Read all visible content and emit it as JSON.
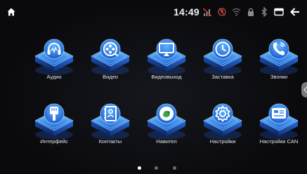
{
  "status_bar": {
    "time": "14:49",
    "icons": [
      "home-icon",
      "signal-off-icon",
      "mic-off-icon",
      "wifi-icon",
      "lock-icon",
      "bluetooth-icon",
      "window-icon",
      "back-arrow-icon"
    ],
    "muted_color": "#8a8a90",
    "alert_color": "#c0392b"
  },
  "apps": [
    {
      "label": "Аудио",
      "icon": "headphones-icon"
    },
    {
      "label": "Видео",
      "icon": "film-reel-icon"
    },
    {
      "label": "Видеовыход",
      "icon": "screen-cast-icon"
    },
    {
      "label": "Заставка",
      "icon": "clock-icon"
    },
    {
      "label": "Звонки",
      "icon": "phone-call-icon"
    },
    {
      "label": "Интерфейс",
      "icon": "paint-brush-icon"
    },
    {
      "label": "Контакты",
      "icon": "contacts-book-icon"
    },
    {
      "label": "Навител",
      "icon": "navitel-logo-icon"
    },
    {
      "label": "Настройки",
      "icon": "gear-icon"
    },
    {
      "label": "Настройки CAN",
      "icon": "can-settings-icon"
    }
  ],
  "pagination": {
    "pages": 3,
    "current": 1
  },
  "colors": {
    "accent": "#2f8fff",
    "tile_glow": "#5fc0ff",
    "background": "#0a0a0d"
  }
}
